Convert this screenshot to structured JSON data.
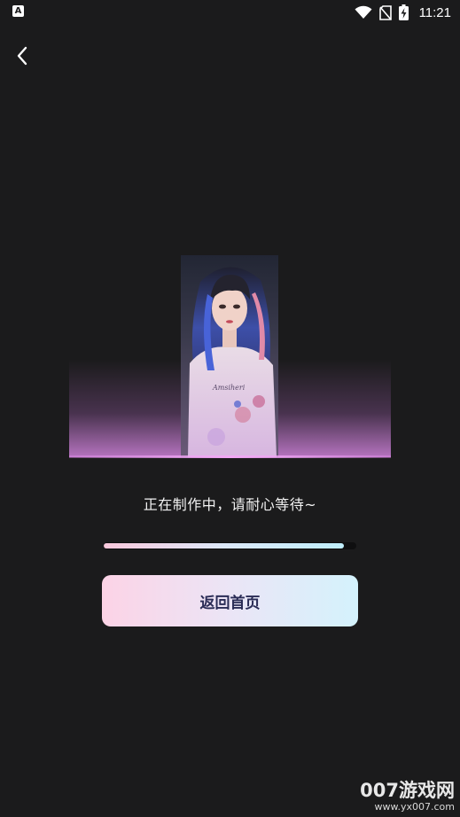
{
  "status_bar": {
    "time": "11:21",
    "icons": [
      "app-notification-icon",
      "wifi-icon",
      "no-sim-icon",
      "battery-charging-icon"
    ]
  },
  "nav": {
    "back_icon": "chevron-left-icon"
  },
  "preview": {
    "image": "generated-portrait-preview"
  },
  "status_text": "正在制作中，请耐心等待~",
  "progress": {
    "fraction": 0.95
  },
  "home_button_label": "返回首页",
  "watermark": {
    "title": "007游戏网",
    "url": "www.yx007.com"
  },
  "colors": {
    "background": "#1b1b1c",
    "button_gradient": [
      "#fcd3e6",
      "#d4f2fc"
    ],
    "button_text": "#2a2c56",
    "glow": "#f2a8f5"
  }
}
